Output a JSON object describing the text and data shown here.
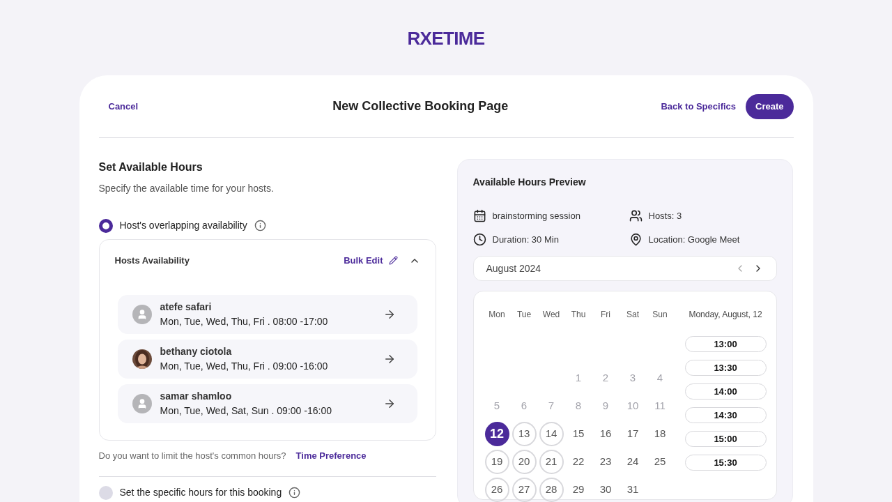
{
  "logo": "RXETIME",
  "header": {
    "cancel": "Cancel",
    "title": "New Collective Booking Page",
    "back": "Back to Specifics",
    "create": "Create"
  },
  "hours": {
    "title": "Set Available Hours",
    "subtitle": "Specify the available time for your hosts.",
    "options": [
      {
        "label": "Host's overlapping availability",
        "selected": true
      },
      {
        "label": "Set the specific hours for this booking",
        "selected": false
      }
    ],
    "panel": {
      "title": "Hosts Availability",
      "bulk_edit": "Bulk Edit",
      "expanded": true,
      "hosts": [
        {
          "name": "atefe safari",
          "schedule": "Mon, Tue, Wed, Thu, Fri . 08:00 -17:00",
          "photo": false
        },
        {
          "name": "bethany ciotola",
          "schedule": "Mon, Tue, Wed, Thu, Fri . 09:00 -16:00",
          "photo": true
        },
        {
          "name": "samar shamloo",
          "schedule": "Mon, Tue, Wed, Sat, Sun . 09:00 -16:00",
          "photo": false
        }
      ]
    },
    "limit_question": "Do you want to limit the host's common hours?",
    "limit_link": "Time Preference"
  },
  "preview": {
    "title": "Available Hours Preview",
    "details": [
      {
        "kind": "event",
        "text": "brainstorming session"
      },
      {
        "kind": "hosts",
        "text": "Hosts: 3"
      },
      {
        "kind": "duration",
        "text": "Duration: 30 Min"
      },
      {
        "kind": "location",
        "text": "Location: Google Meet"
      }
    ],
    "month": "August 2024",
    "weekdays": [
      "Mon",
      "Tue",
      "Wed",
      "Thu",
      "Fri",
      "Sat",
      "Sun"
    ],
    "days": [
      {
        "kind": "blank"
      },
      {
        "kind": "blank"
      },
      {
        "kind": "blank"
      },
      {
        "label": "1",
        "kind": "past",
        "selected": false
      },
      {
        "label": "2",
        "kind": "past",
        "selected": false
      },
      {
        "label": "3",
        "kind": "past",
        "selected": false
      },
      {
        "label": "4",
        "kind": "past",
        "selected": false
      },
      {
        "label": "5",
        "kind": "past",
        "selected": false
      },
      {
        "label": "6",
        "kind": "past",
        "selected": false
      },
      {
        "label": "7",
        "kind": "past",
        "selected": false
      },
      {
        "label": "8",
        "kind": "past",
        "selected": false
      },
      {
        "label": "9",
        "kind": "past",
        "selected": false
      },
      {
        "label": "10",
        "kind": "past",
        "selected": false
      },
      {
        "label": "11",
        "kind": "past",
        "selected": false
      },
      {
        "label": "12",
        "kind": "available",
        "selected": true
      },
      {
        "label": "13",
        "kind": "available",
        "selected": false
      },
      {
        "label": "14",
        "kind": "available",
        "selected": false
      },
      {
        "label": "15",
        "kind": "plain",
        "selected": false
      },
      {
        "label": "16",
        "kind": "plain",
        "selected": false
      },
      {
        "label": "17",
        "kind": "plain",
        "selected": false
      },
      {
        "label": "18",
        "kind": "plain",
        "selected": false
      },
      {
        "label": "19",
        "kind": "available",
        "selected": false
      },
      {
        "label": "20",
        "kind": "available",
        "selected": false
      },
      {
        "label": "21",
        "kind": "available",
        "selected": false
      },
      {
        "label": "22",
        "kind": "plain",
        "selected": false
      },
      {
        "label": "23",
        "kind": "plain",
        "selected": false
      },
      {
        "label": "24",
        "kind": "plain",
        "selected": false
      },
      {
        "label": "25",
        "kind": "plain",
        "selected": false
      },
      {
        "label": "26",
        "kind": "available",
        "selected": false
      },
      {
        "label": "27",
        "kind": "available",
        "selected": false
      },
      {
        "label": "28",
        "kind": "available",
        "selected": false
      },
      {
        "label": "29",
        "kind": "plain",
        "selected": false
      },
      {
        "label": "30",
        "kind": "plain",
        "selected": false
      },
      {
        "label": "31",
        "kind": "plain",
        "selected": false
      }
    ],
    "day_title": "Monday, August, 12",
    "slots": [
      "13:00",
      "13:30",
      "14:00",
      "14:30",
      "15:00",
      "15:30"
    ]
  }
}
